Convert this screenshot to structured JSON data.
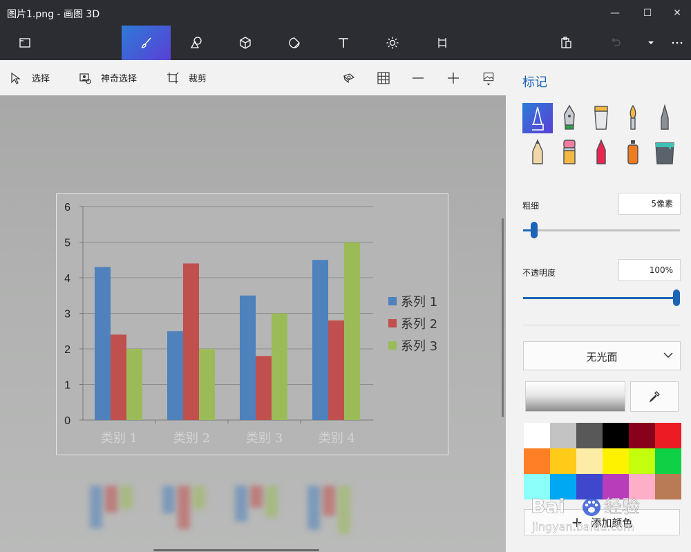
{
  "window": {
    "title": "图片1.png - 画图 3D"
  },
  "toolbar": {
    "tools": [
      "menu-folder",
      "brushes",
      "2d-shapes",
      "3d-shapes",
      "stickers",
      "text",
      "effects",
      "canvas"
    ],
    "active_tool": "brushes"
  },
  "subbar": {
    "select_label": "选择",
    "magic_select_label": "神奇选择",
    "crop_label": "裁剪"
  },
  "panel": {
    "title": "标记",
    "thickness_label": "粗细",
    "thickness_value": "5像素",
    "thickness_level": 0.05,
    "opacity_label": "不透明度",
    "opacity_value": "100%",
    "opacity_level": 1.0,
    "finish_value": "无光面",
    "add_color_label": "添加颜色",
    "palette": [
      "#ffffff",
      "#c3c3c3",
      "#585858",
      "#000000",
      "#88001b",
      "#ec1c24",
      "#ff7f27",
      "#ffca18",
      "#fdeca6",
      "#fff200",
      "#c4ff0e",
      "#0ed145",
      "#8cfffb",
      "#00a8f3",
      "#3f48cc",
      "#b83dba",
      "#ffaec8",
      "#b97a56"
    ]
  },
  "watermark": {
    "brand": "Bai",
    "brand_suffix": "经验",
    "url": "jingyan.baidu.com"
  },
  "chart_data": {
    "type": "bar",
    "categories": [
      "类别 1",
      "类别 2",
      "类别 3",
      "类别 4"
    ],
    "series": [
      {
        "name": "系列 1",
        "values": [
          4.3,
          2.5,
          3.5,
          4.5
        ],
        "color": "#4f81bd"
      },
      {
        "name": "系列 2",
        "values": [
          2.4,
          4.4,
          1.8,
          2.8
        ],
        "color": "#c0504d"
      },
      {
        "name": "系列 3",
        "values": [
          2.0,
          2.0,
          3.0,
          5.0
        ],
        "color": "#9bbb59"
      }
    ],
    "yticks": [
      "0",
      "1",
      "2",
      "3",
      "4",
      "5",
      "6"
    ],
    "ylim": [
      0,
      6
    ],
    "grid": true,
    "legend": "right"
  }
}
